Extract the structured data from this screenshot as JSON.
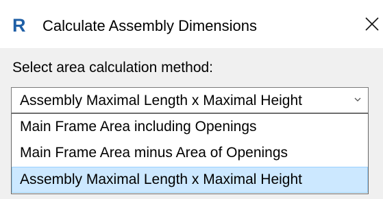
{
  "window": {
    "app_icon_letter": "R",
    "title": "Calculate Assembly Dimensions",
    "close_icon": "close-icon"
  },
  "dialog": {
    "prompt": "Select area calculation method:",
    "combo": {
      "selected": "Assembly Maximal Length x Maximal Height",
      "arrow_icon": "chevron-down-icon"
    },
    "options": [
      {
        "label": "Main Frame Area including Openings",
        "selected": false
      },
      {
        "label": "Main Frame Area minus Area of Openings",
        "selected": false
      },
      {
        "label": "Assembly Maximal Length x Maximal Height",
        "selected": true
      }
    ]
  },
  "colors": {
    "icon_blue": "#1f5fa6",
    "selection_bg": "#cce8ff",
    "dialog_bg": "#f0f0f0"
  }
}
